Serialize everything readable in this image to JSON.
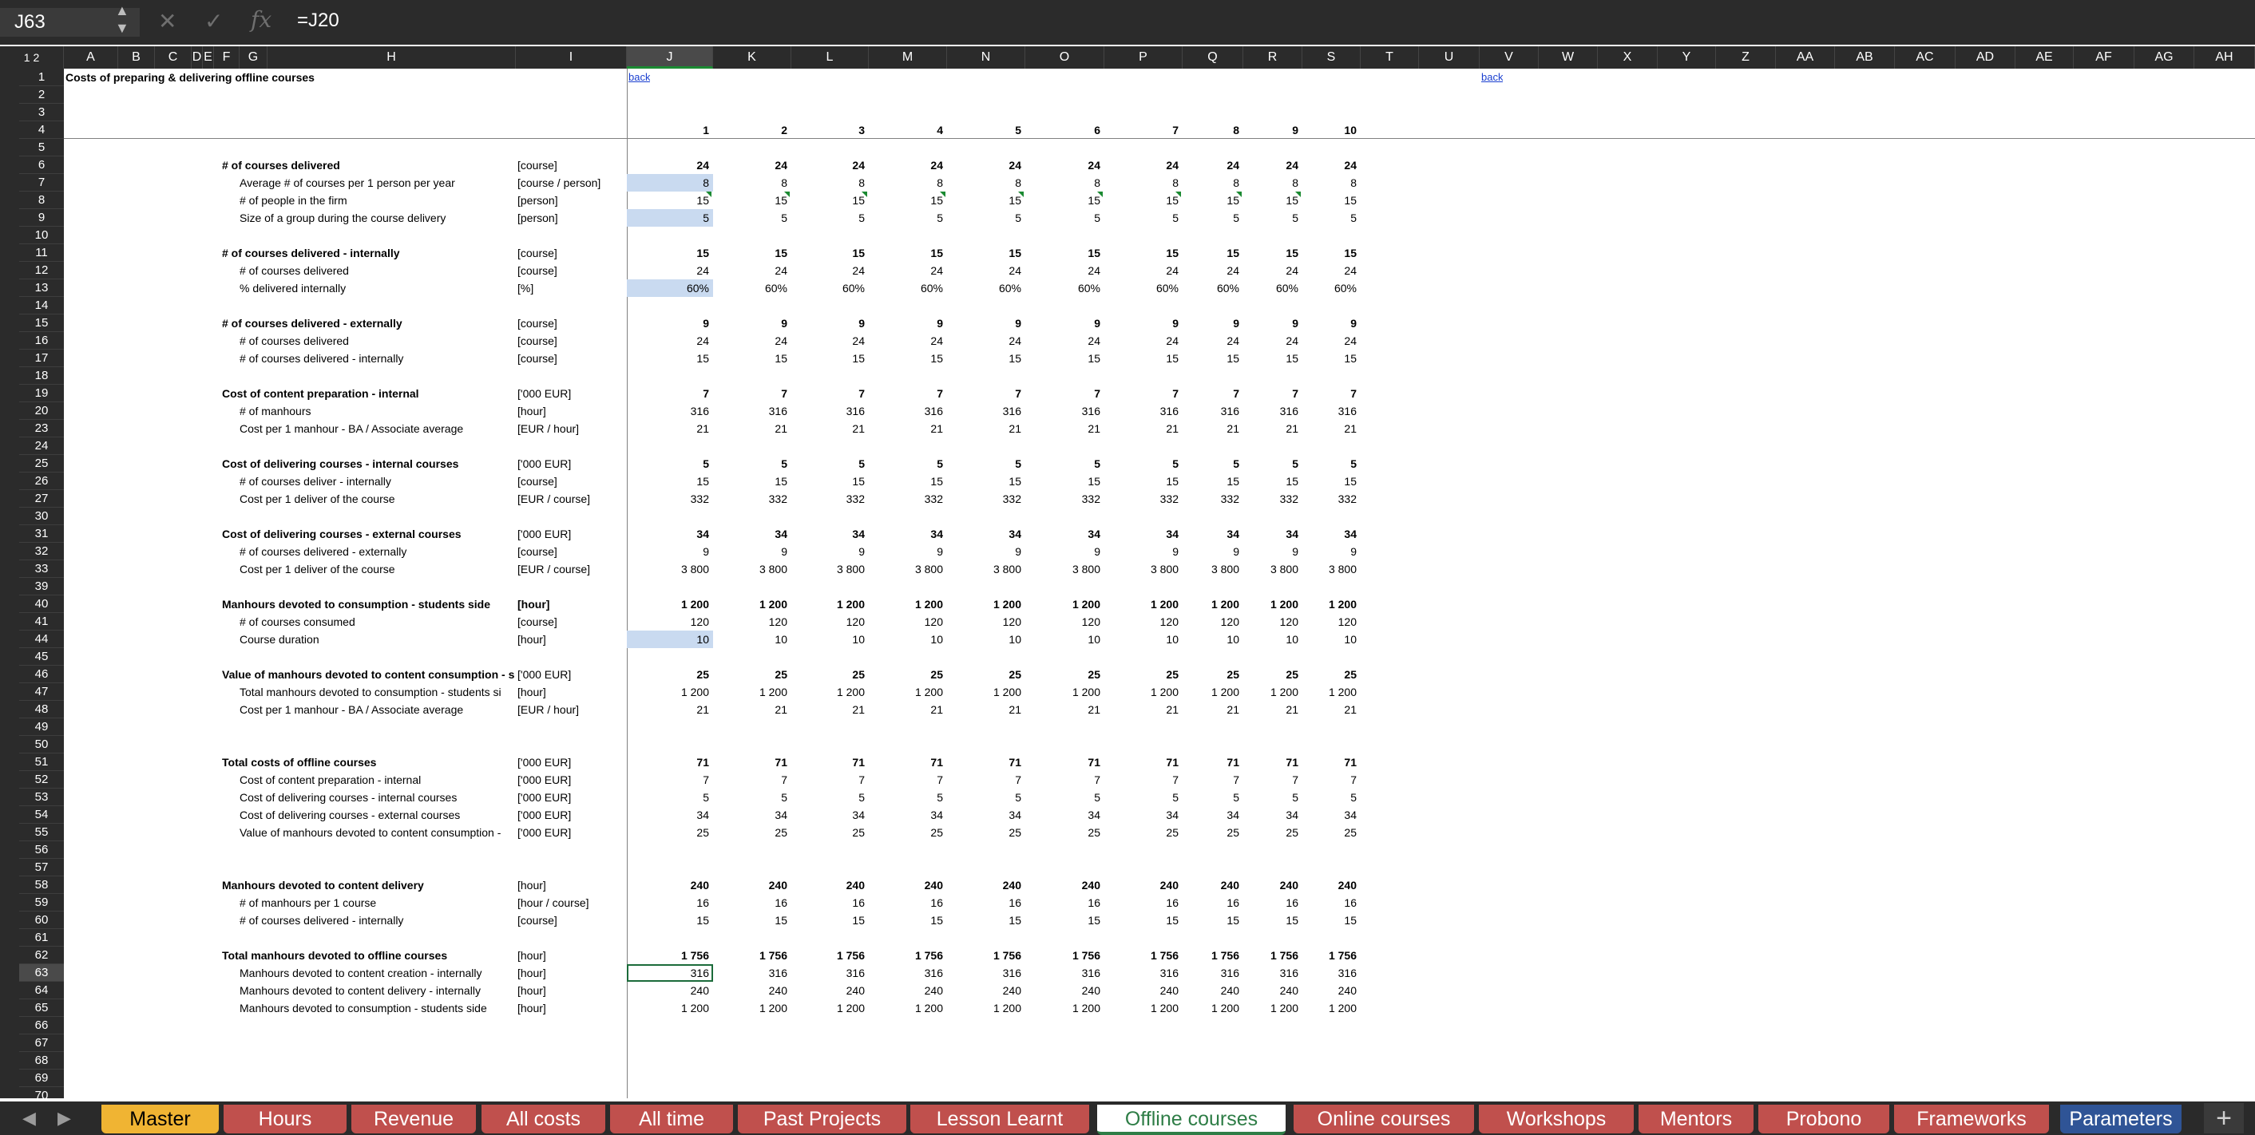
{
  "formula_bar": {
    "name_box": "J63",
    "formula": "=J20"
  },
  "icons": {
    "cancel": "close-icon",
    "confirm": "check-icon",
    "function": "fx-icon",
    "add_sheet": "plus-icon"
  },
  "columns": [
    "A",
    "B",
    "C",
    "D",
    "E",
    "F",
    "G",
    "H",
    "I",
    "J",
    "K",
    "L",
    "M",
    "N",
    "O",
    "P",
    "Q",
    "R",
    "S",
    "T",
    "U",
    "V",
    "W",
    "X",
    "Y",
    "Z",
    "AA",
    "AB",
    "AC",
    "AD",
    "AE",
    "AF",
    "AG",
    "AH"
  ],
  "outline_levels": "1 2",
  "row_numbers": [
    1,
    2,
    3,
    4,
    5,
    6,
    7,
    8,
    9,
    10,
    11,
    12,
    13,
    14,
    15,
    16,
    17,
    18,
    19,
    20,
    23,
    24,
    25,
    26,
    27,
    30,
    31,
    32,
    33,
    39,
    40,
    41,
    44,
    45,
    46,
    47,
    48,
    49,
    50,
    51,
    52,
    53,
    54,
    55,
    56,
    57,
    58,
    59,
    60,
    61,
    62,
    63,
    64,
    65,
    66,
    67,
    68,
    69,
    70
  ],
  "collapsed_rows": [
    23,
    30,
    39,
    44
  ],
  "sheet": {
    "title": "Costs of preparing & delivering offline courses",
    "back_link": "back",
    "period_numbers": [
      1,
      2,
      3,
      4,
      5,
      6,
      7,
      8,
      9,
      10
    ],
    "rows": [
      {
        "r": 6,
        "label": "# of courses delivered",
        "unit": "[course]",
        "bold": true,
        "v": [
          "24",
          "24",
          "24",
          "24",
          "24",
          "24",
          "24",
          "24",
          "24",
          "24"
        ]
      },
      {
        "r": 7,
        "label": "Average # of courses per 1 person per year",
        "unit": "[course / person]",
        "indent": true,
        "input": true,
        "v": [
          "8",
          "8",
          "8",
          "8",
          "8",
          "8",
          "8",
          "8",
          "8",
          "8"
        ]
      },
      {
        "r": 8,
        "label": "# of people in the firm",
        "unit": "[person]",
        "indent": true,
        "comment": true,
        "v": [
          "15",
          "15",
          "15",
          "15",
          "15",
          "15",
          "15",
          "15",
          "15",
          "15"
        ]
      },
      {
        "r": 9,
        "label": "Size of a group during the course delivery",
        "unit": "[person]",
        "indent": true,
        "input": true,
        "v": [
          "5",
          "5",
          "5",
          "5",
          "5",
          "5",
          "5",
          "5",
          "5",
          "5"
        ]
      },
      {
        "r": 11,
        "label": "# of courses delivered - internally",
        "unit": "[course]",
        "bold": true,
        "v": [
          "15",
          "15",
          "15",
          "15",
          "15",
          "15",
          "15",
          "15",
          "15",
          "15"
        ]
      },
      {
        "r": 12,
        "label": "# of courses delivered",
        "unit": "[course]",
        "indent": true,
        "v": [
          "24",
          "24",
          "24",
          "24",
          "24",
          "24",
          "24",
          "24",
          "24",
          "24"
        ]
      },
      {
        "r": 13,
        "label": "% delivered internally",
        "unit": "[%]",
        "indent": true,
        "input": true,
        "v": [
          "60%",
          "60%",
          "60%",
          "60%",
          "60%",
          "60%",
          "60%",
          "60%",
          "60%",
          "60%"
        ]
      },
      {
        "r": 15,
        "label": "# of courses delivered - externally",
        "unit": "[course]",
        "bold": true,
        "v": [
          "9",
          "9",
          "9",
          "9",
          "9",
          "9",
          "9",
          "9",
          "9",
          "9"
        ]
      },
      {
        "r": 16,
        "label": "# of courses delivered",
        "unit": "[course]",
        "indent": true,
        "v": [
          "24",
          "24",
          "24",
          "24",
          "24",
          "24",
          "24",
          "24",
          "24",
          "24"
        ]
      },
      {
        "r": 17,
        "label": "# of courses delivered - internally",
        "unit": "[course]",
        "indent": true,
        "v": [
          "15",
          "15",
          "15",
          "15",
          "15",
          "15",
          "15",
          "15",
          "15",
          "15"
        ]
      },
      {
        "r": 19,
        "label": "Cost of content preparation - internal",
        "unit": "['000 EUR]",
        "bold": true,
        "v": [
          "7",
          "7",
          "7",
          "7",
          "7",
          "7",
          "7",
          "7",
          "7",
          "7"
        ]
      },
      {
        "r": 20,
        "label": "# of manhours",
        "unit": "[hour]",
        "indent": true,
        "v": [
          "316",
          "316",
          "316",
          "316",
          "316",
          "316",
          "316",
          "316",
          "316",
          "316"
        ]
      },
      {
        "r": 23,
        "label": "Cost per 1 manhour - BA / Associate average",
        "unit": "[EUR / hour]",
        "indent": true,
        "v": [
          "21",
          "21",
          "21",
          "21",
          "21",
          "21",
          "21",
          "21",
          "21",
          "21"
        ]
      },
      {
        "r": 25,
        "label": "Cost of delivering courses - internal courses",
        "unit": "['000 EUR]",
        "bold": true,
        "v": [
          "5",
          "5",
          "5",
          "5",
          "5",
          "5",
          "5",
          "5",
          "5",
          "5"
        ]
      },
      {
        "r": 26,
        "label": "# of courses deliver - internally",
        "unit": "[course]",
        "indent": true,
        "v": [
          "15",
          "15",
          "15",
          "15",
          "15",
          "15",
          "15",
          "15",
          "15",
          "15"
        ]
      },
      {
        "r": 27,
        "label": "Cost per 1 deliver of the course",
        "unit": "[EUR / course]",
        "indent": true,
        "v": [
          "332",
          "332",
          "332",
          "332",
          "332",
          "332",
          "332",
          "332",
          "332",
          "332"
        ]
      },
      {
        "r": 31,
        "label": "Cost of delivering courses - external courses",
        "unit": "['000 EUR]",
        "bold": true,
        "v": [
          "34",
          "34",
          "34",
          "34",
          "34",
          "34",
          "34",
          "34",
          "34",
          "34"
        ]
      },
      {
        "r": 32,
        "label": "# of courses delivered - externally",
        "unit": "[course]",
        "indent": true,
        "v": [
          "9",
          "9",
          "9",
          "9",
          "9",
          "9",
          "9",
          "9",
          "9",
          "9"
        ]
      },
      {
        "r": 33,
        "label": "Cost per 1 deliver of the course",
        "unit": "[EUR / course]",
        "indent": true,
        "v": [
          "3 800",
          "3 800",
          "3 800",
          "3 800",
          "3 800",
          "3 800",
          "3 800",
          "3 800",
          "3 800",
          "3 800"
        ]
      },
      {
        "r": 40,
        "label": "Manhours devoted to consumption - students side",
        "unit": "[hour]",
        "bold": true,
        "v": [
          "1 200",
          "1 200",
          "1 200",
          "1 200",
          "1 200",
          "1 200",
          "1 200",
          "1 200",
          "1 200",
          "1 200"
        ]
      },
      {
        "r": 41,
        "label": "# of courses consumed",
        "unit": "[course]",
        "indent": true,
        "v": [
          "120",
          "120",
          "120",
          "120",
          "120",
          "120",
          "120",
          "120",
          "120",
          "120"
        ]
      },
      {
        "r": 44,
        "label": "Course duration",
        "unit": "[hour]",
        "indent": true,
        "input": true,
        "v": [
          "10",
          "10",
          "10",
          "10",
          "10",
          "10",
          "10",
          "10",
          "10",
          "10"
        ]
      },
      {
        "r": 46,
        "label": "Value of manhours devoted to content consumption - st",
        "unit": "['000 EUR]",
        "bold": true,
        "v": [
          "25",
          "25",
          "25",
          "25",
          "25",
          "25",
          "25",
          "25",
          "25",
          "25"
        ]
      },
      {
        "r": 47,
        "label": "Total manhours devoted to consumption - students si",
        "unit": "[hour]",
        "indent": true,
        "v": [
          "1 200",
          "1 200",
          "1 200",
          "1 200",
          "1 200",
          "1 200",
          "1 200",
          "1 200",
          "1 200",
          "1 200"
        ]
      },
      {
        "r": 48,
        "label": "Cost per 1 manhour - BA / Associate average",
        "unit": "[EUR / hour]",
        "indent": true,
        "v": [
          "21",
          "21",
          "21",
          "21",
          "21",
          "21",
          "21",
          "21",
          "21",
          "21"
        ]
      },
      {
        "r": 51,
        "label": "Total costs of offline courses",
        "unit": "['000 EUR]",
        "bold": true,
        "v": [
          "71",
          "71",
          "71",
          "71",
          "71",
          "71",
          "71",
          "71",
          "71",
          "71"
        ]
      },
      {
        "r": 52,
        "label": "Cost of content preparation - internal",
        "unit": "['000 EUR]",
        "indent": true,
        "v": [
          "7",
          "7",
          "7",
          "7",
          "7",
          "7",
          "7",
          "7",
          "7",
          "7"
        ]
      },
      {
        "r": 53,
        "label": "Cost of delivering courses - internal courses",
        "unit": "['000 EUR]",
        "indent": true,
        "v": [
          "5",
          "5",
          "5",
          "5",
          "5",
          "5",
          "5",
          "5",
          "5",
          "5"
        ]
      },
      {
        "r": 54,
        "label": "Cost of delivering courses - external courses",
        "unit": "['000 EUR]",
        "indent": true,
        "v": [
          "34",
          "34",
          "34",
          "34",
          "34",
          "34",
          "34",
          "34",
          "34",
          "34"
        ]
      },
      {
        "r": 55,
        "label": "Value of manhours devoted to content consumption -",
        "unit": "['000 EUR]",
        "indent": true,
        "v": [
          "25",
          "25",
          "25",
          "25",
          "25",
          "25",
          "25",
          "25",
          "25",
          "25"
        ]
      },
      {
        "r": 58,
        "label": "Manhours devoted to content delivery",
        "unit": "[hour]",
        "bold": true,
        "v": [
          "240",
          "240",
          "240",
          "240",
          "240",
          "240",
          "240",
          "240",
          "240",
          "240"
        ]
      },
      {
        "r": 59,
        "label": "# of manhours per 1 course",
        "unit": "[hour / course]",
        "indent": true,
        "v": [
          "16",
          "16",
          "16",
          "16",
          "16",
          "16",
          "16",
          "16",
          "16",
          "16"
        ]
      },
      {
        "r": 60,
        "label": "# of courses delivered - internally",
        "unit": "[course]",
        "indent": true,
        "v": [
          "15",
          "15",
          "15",
          "15",
          "15",
          "15",
          "15",
          "15",
          "15",
          "15"
        ]
      },
      {
        "r": 62,
        "label": "Total manhours devoted to offline courses",
        "unit": "[hour]",
        "bold": true,
        "v": [
          "1 756",
          "1 756",
          "1 756",
          "1 756",
          "1 756",
          "1 756",
          "1 756",
          "1 756",
          "1 756",
          "1 756"
        ]
      },
      {
        "r": 63,
        "label": "Manhours devoted to content creation - internally",
        "unit": "[hour]",
        "indent": true,
        "selected": true,
        "v": [
          "316",
          "316",
          "316",
          "316",
          "316",
          "316",
          "316",
          "316",
          "316",
          "316"
        ]
      },
      {
        "r": 64,
        "label": "Manhours devoted to content delivery - internally",
        "unit": "[hour]",
        "indent": true,
        "v": [
          "240",
          "240",
          "240",
          "240",
          "240",
          "240",
          "240",
          "240",
          "240",
          "240"
        ]
      },
      {
        "r": 65,
        "label": "Manhours devoted to consumption - students side",
        "unit": "[hour]",
        "indent": true,
        "v": [
          "1 200",
          "1 200",
          "1 200",
          "1 200",
          "1 200",
          "1 200",
          "1 200",
          "1 200",
          "1 200",
          "1 200"
        ]
      }
    ]
  },
  "tabs": [
    {
      "label": "Master",
      "color": "#f0b433",
      "text_color": "#000000"
    },
    {
      "label": "Hours",
      "color": "#c0504d",
      "text_color": "#ffffff"
    },
    {
      "label": "Revenue",
      "color": "#c0504d",
      "text_color": "#ffffff"
    },
    {
      "label": "All costs",
      "color": "#c0504d",
      "text_color": "#ffffff"
    },
    {
      "label": "All time",
      "color": "#c0504d",
      "text_color": "#ffffff"
    },
    {
      "label": "Past Projects",
      "color": "#c0504d",
      "text_color": "#ffffff"
    },
    {
      "label": "Lesson Learnt",
      "color": "#c0504d",
      "text_color": "#ffffff"
    },
    {
      "label": "Offline courses",
      "color": "#ffffff",
      "text_color": "#2e7d46",
      "active": true
    },
    {
      "label": "Online courses",
      "color": "#c0504d",
      "text_color": "#ffffff"
    },
    {
      "label": "Workshops",
      "color": "#c0504d",
      "text_color": "#ffffff"
    },
    {
      "label": "Mentors",
      "color": "#c0504d",
      "text_color": "#ffffff"
    },
    {
      "label": "Probono",
      "color": "#c0504d",
      "text_color": "#ffffff"
    },
    {
      "label": "Frameworks",
      "color": "#c0504d",
      "text_color": "#ffffff"
    },
    {
      "label": "Parameters",
      "color": "#2f5496",
      "text_color": "#ffffff"
    }
  ]
}
